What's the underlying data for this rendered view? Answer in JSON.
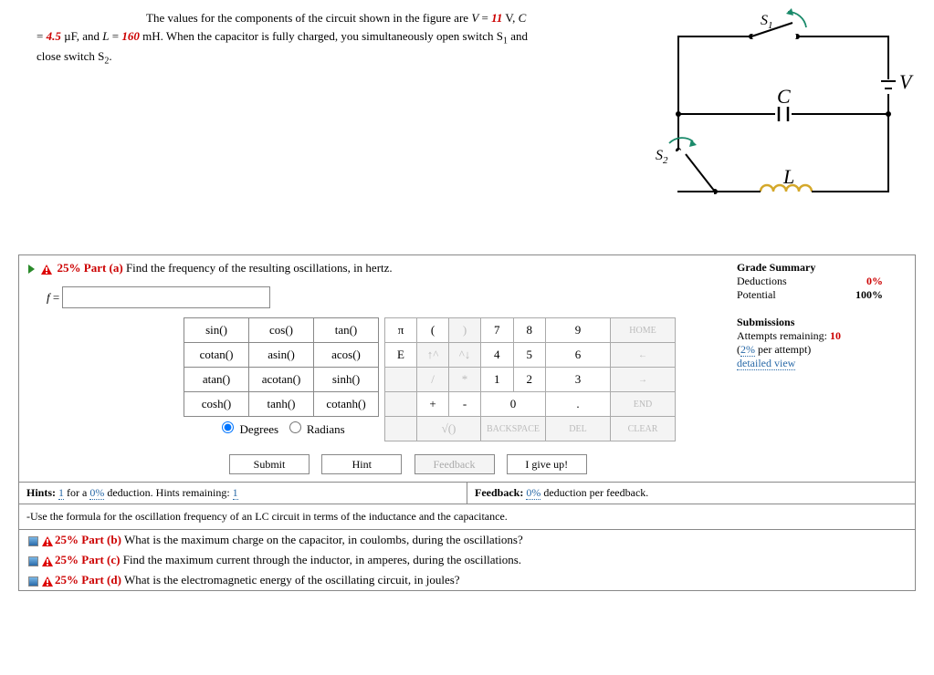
{
  "problem": {
    "intro1": "The values for the components of the circuit shown in the figure are ",
    "Vsym": "V",
    "eq": " = ",
    "Vval": "11",
    "Vunit": " V, ",
    "Csym": "C",
    "Cval": "4.5",
    "Cunit": " µF, and ",
    "Lsym": "L",
    "Lval": "160",
    "Lunit": " mH. When the capacitor is fully charged, you simultaneously open switch S",
    "s1sub": "1",
    "mid": " and close switch S",
    "s2sub": "2",
    "end": "."
  },
  "figure": {
    "S1": "S",
    "S1sub": "1",
    "C": "C",
    "V": "V",
    "S2": "S",
    "S2sub": "2",
    "L": "L"
  },
  "partA": {
    "pct": "25% Part (a)",
    "text": "  Find the frequency of the resulting oscillations, in hertz.",
    "var": "f",
    "eq": " = "
  },
  "funcs": [
    [
      "sin()",
      "cos()",
      "tan()"
    ],
    [
      "cotan()",
      "asin()",
      "acos()"
    ],
    [
      "atan()",
      "acotan()",
      "sinh()"
    ],
    [
      "cosh()",
      "tanh()",
      "cotanh()"
    ]
  ],
  "degrad": {
    "deg": "Degrees",
    "rad": "Radians"
  },
  "nums": [
    [
      "π",
      "(",
      ")",
      "7",
      "8",
      "9",
      "HOME"
    ],
    [
      "E",
      "↑^",
      "^↓",
      "4",
      "5",
      "6",
      "←"
    ],
    [
      "",
      "/",
      "*",
      "1",
      "2",
      "3",
      "→"
    ],
    [
      "",
      "+",
      "-",
      "0",
      ".",
      "END"
    ],
    [
      "",
      "√()",
      "BACKSPACE",
      "DEL",
      "CLEAR"
    ]
  ],
  "actions": {
    "submit": "Submit",
    "hint": "Hint",
    "feedback": "Feedback",
    "giveup": "I give up!"
  },
  "hints": {
    "left_pre": "Hints: ",
    "left_n1": "1",
    "left_mid": " for a ",
    "left_pct": "0%",
    "left_mid2": " deduction. Hints remaining: ",
    "left_n2": "1",
    "right_pre": "Feedback: ",
    "right_pct": "0%",
    "right_post": " deduction per feedback.",
    "body": "-Use the formula for the oscillation frequency of an LC circuit in terms of the inductance and the capacitance."
  },
  "partB": {
    "pct": "25% Part (b)",
    "text": "  What is the maximum charge on the capacitor, in coulombs, during the oscillations?"
  },
  "partC": {
    "pct": "25% Part (c)",
    "text": "  Find the maximum current through the inductor, in amperes, during the oscillations."
  },
  "partD": {
    "pct": "25% Part (d)",
    "text": "  What is the electromagnetic energy of the oscillating circuit, in joules?"
  },
  "grade": {
    "title": "Grade Summary",
    "ded": "Deductions",
    "dedv": "0%",
    "pot": "Potential",
    "potv": "100%",
    "sub": "Submissions",
    "att_pre": "Attempts remaining: ",
    "att_n": "10",
    "per_pre": "(",
    "per_pct": "2%",
    "per_post": " per attempt)",
    "detail": "detailed view"
  }
}
